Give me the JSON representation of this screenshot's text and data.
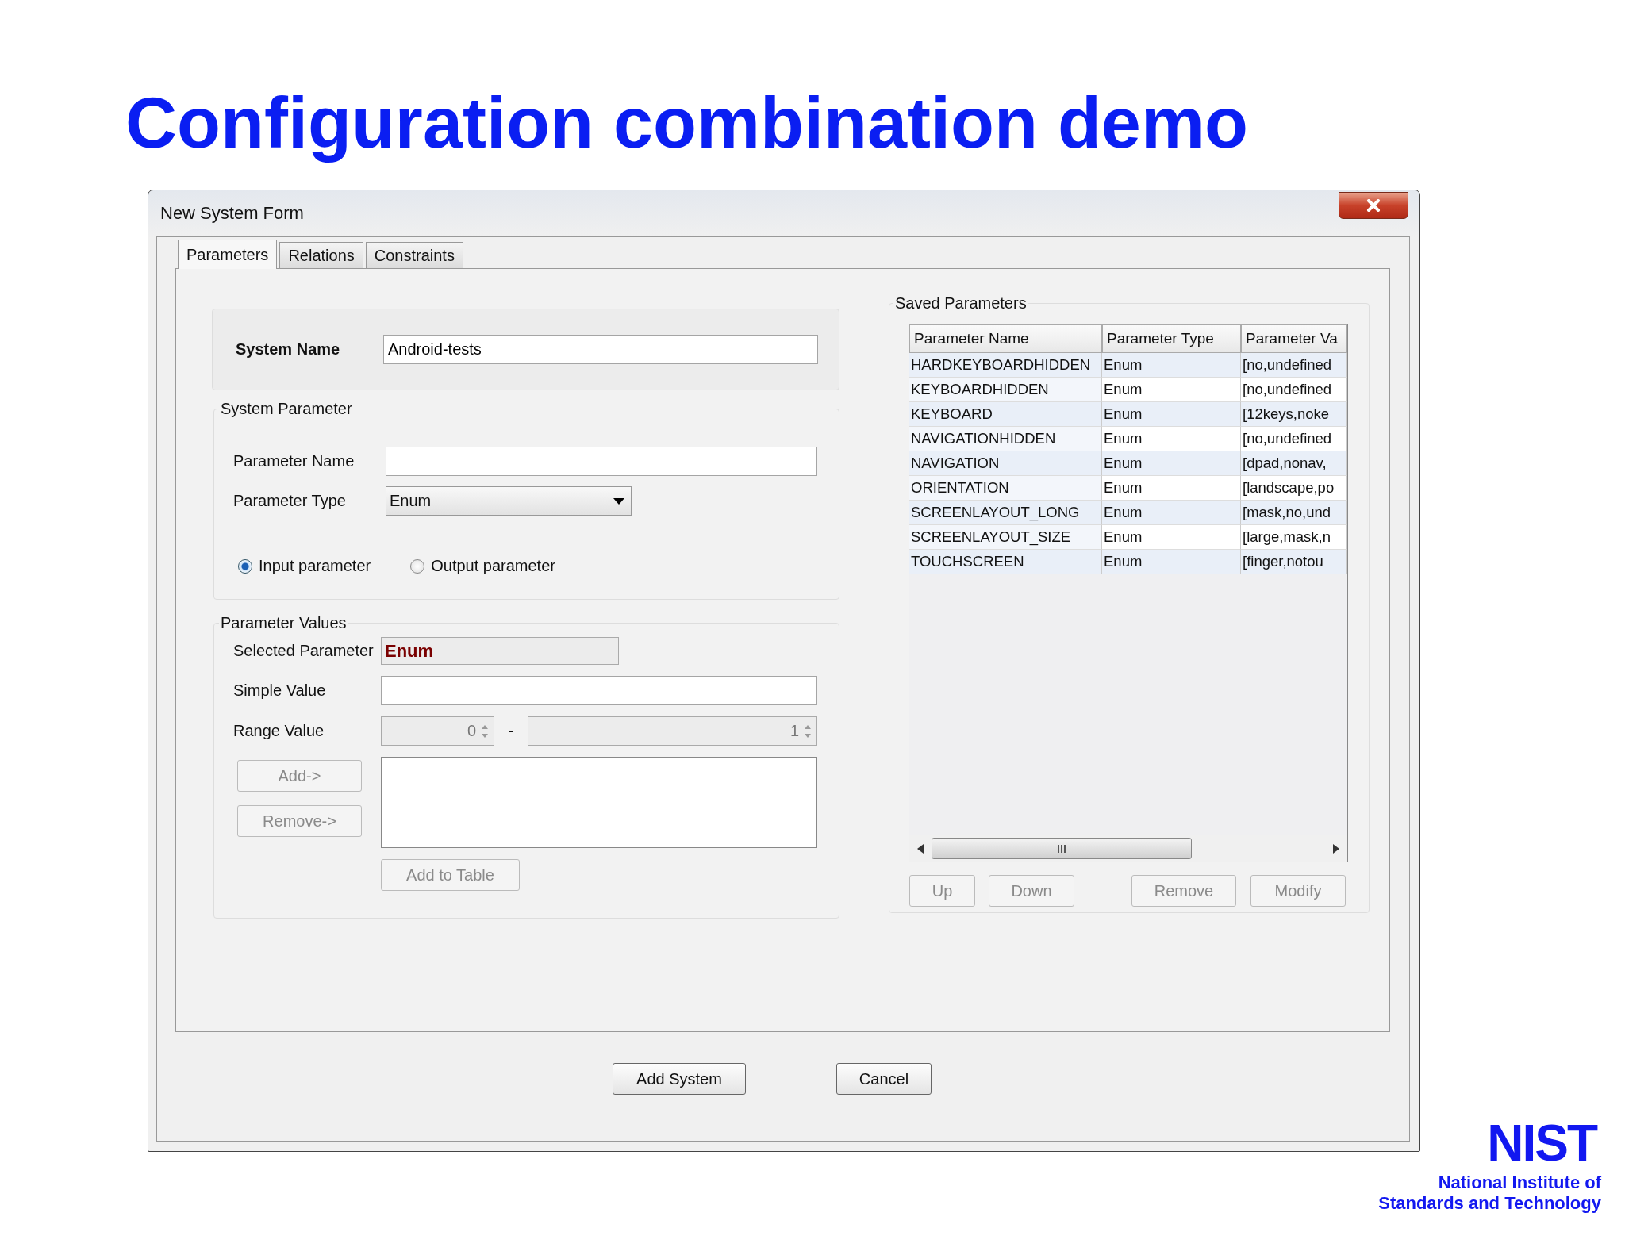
{
  "slide": {
    "title": "Configuration combination demo"
  },
  "window": {
    "title": "New System Form"
  },
  "tabs": [
    {
      "label": "Parameters",
      "selected": true
    },
    {
      "label": "Relations",
      "selected": false
    },
    {
      "label": "Constraints",
      "selected": false
    }
  ],
  "system_name": {
    "label": "System Name",
    "value": "Android-tests"
  },
  "system_parameter": {
    "title": "System Parameter",
    "parameter_name": {
      "label": "Parameter Name"
    },
    "parameter_type": {
      "label": "Parameter Type",
      "value": "Enum"
    },
    "radios": [
      {
        "label": "Input parameter",
        "selected": true
      },
      {
        "label": "Output parameter",
        "selected": false
      }
    ]
  },
  "parameter_values": {
    "title": "Parameter Values",
    "selected_parameter": {
      "label": "Selected Parameter",
      "value": "Enum"
    },
    "simple_value": {
      "label": "Simple Value"
    },
    "range_value": {
      "label": "Range Value",
      "from": "0",
      "separator": "-",
      "to": "1",
      "disabled": true
    },
    "buttons": [
      {
        "label": "Add->",
        "disabled": true
      },
      {
        "label": "Remove->",
        "disabled": true
      }
    ],
    "add_to_table": {
      "label": "Add to Table",
      "disabled": true
    }
  },
  "saved_parameters": {
    "title": "Saved Parameters",
    "table": {
      "columns": [
        "Parameter Name",
        "Parameter Type",
        "Parameter Va"
      ],
      "rows": [
        [
          "HARDKEYBOARDHIDDEN",
          "Enum",
          "[no,undefined"
        ],
        [
          "KEYBOARDHIDDEN",
          "Enum",
          "[no,undefined"
        ],
        [
          "KEYBOARD",
          "Enum",
          "[12keys,noke"
        ],
        [
          "NAVIGATIONHIDDEN",
          "Enum",
          "[no,undefined"
        ],
        [
          "NAVIGATION",
          "Enum",
          "[dpad,nonav,"
        ],
        [
          "ORIENTATION",
          "Enum",
          "[landscape,po"
        ],
        [
          "SCREENLAYOUT_LONG",
          "Enum",
          "[mask,no,und"
        ],
        [
          "SCREENLAYOUT_SIZE",
          "Enum",
          "[large,mask,n"
        ],
        [
          "TOUCHSCREEN",
          "Enum",
          "[finger,notou"
        ]
      ]
    },
    "buttons": [
      {
        "label": "Up",
        "disabled": true
      },
      {
        "label": "Down",
        "disabled": true
      },
      {
        "label": "Remove",
        "disabled": true
      },
      {
        "label": "Modify",
        "disabled": true
      }
    ]
  },
  "dialog_buttons": [
    {
      "label": "Add System",
      "disabled": false
    },
    {
      "label": "Cancel",
      "disabled": false
    }
  ],
  "logo": {
    "mark": "NIST",
    "lines": [
      "National Institute of",
      "Standards and Technology"
    ]
  }
}
